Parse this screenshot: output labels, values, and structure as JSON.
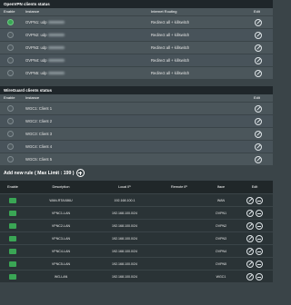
{
  "openvpn": {
    "title": "OpenVPN clients status",
    "headers": {
      "enable": "Enable",
      "instance": "Instance",
      "routing": "Internet Routing",
      "edit": "Edit"
    },
    "rows": [
      {
        "instance": "OVPN1: udp",
        "routing": "Redirect all + killswitch",
        "enabled": true
      },
      {
        "instance": "OVPN2: udp",
        "routing": "Redirect all + killswitch",
        "enabled": false
      },
      {
        "instance": "OVPN3: udp",
        "routing": "Redirect all + killswitch",
        "enabled": false
      },
      {
        "instance": "OVPN4: udp",
        "routing": "Redirect all + killswitch",
        "enabled": false
      },
      {
        "instance": "OVPN5: udp",
        "routing": "Redirect all + killswitch",
        "enabled": false
      }
    ]
  },
  "wireguard": {
    "title": "WireGuard clients status",
    "headers": {
      "enable": "Enable",
      "instance": "Instance",
      "edit": "Edit"
    },
    "rows": [
      {
        "instance": "WGC1: Client 1",
        "enabled": false
      },
      {
        "instance": "WGC2: Client 2",
        "enabled": false
      },
      {
        "instance": "WGC3: Client 3",
        "enabled": false
      },
      {
        "instance": "WGC4: Client 4",
        "enabled": false
      },
      {
        "instance": "WGC5: Client 5",
        "enabled": false
      }
    ]
  },
  "rules": {
    "add_label": "Add new rule ( Max Limit : 199 )",
    "headers": {
      "enable": "Enable",
      "description": "Description",
      "local_ip": "Local IP",
      "remote_ip": "Remote IP",
      "iface": "Iface",
      "edit": "Edit"
    },
    "rows": [
      {
        "description": "WAN-RTAX86U",
        "local_ip": "192.168.100.1",
        "remote_ip": "",
        "iface": "WAN",
        "enabled": true
      },
      {
        "description": "VPNC1-LAN",
        "local_ip": "192.168.100.0/24",
        "remote_ip": "",
        "iface": "OVPN1",
        "enabled": true
      },
      {
        "description": "VPNC2-LAN",
        "local_ip": "192.168.100.0/24",
        "remote_ip": "",
        "iface": "OVPN2",
        "enabled": true
      },
      {
        "description": "VPNC3-LAN",
        "local_ip": "192.168.100.0/24",
        "remote_ip": "",
        "iface": "OVPN3",
        "enabled": true
      },
      {
        "description": "VPNC4-LAN",
        "local_ip": "192.168.100.0/24",
        "remote_ip": "",
        "iface": "OVPN4",
        "enabled": true
      },
      {
        "description": "VPNC5-LAN",
        "local_ip": "192.168.100.0/24",
        "remote_ip": "",
        "iface": "OVPN5",
        "enabled": true
      },
      {
        "description": "WG-LAN",
        "local_ip": "192.168.100.0/24",
        "remote_ip": "",
        "iface": "WGC1",
        "enabled": true
      }
    ]
  }
}
